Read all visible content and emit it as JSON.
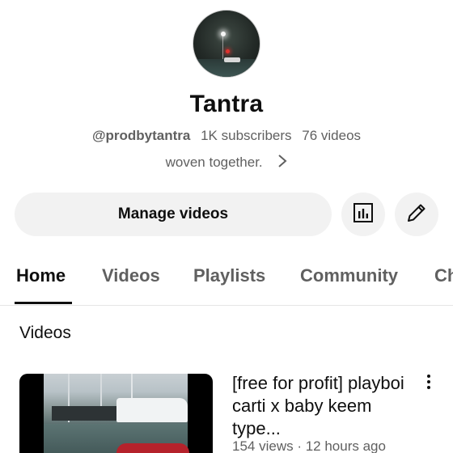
{
  "channel": {
    "name": "Tantra",
    "handle": "@prodbytantra",
    "subscribers": "1K subscribers",
    "videos_count": "76 videos",
    "description": "woven together."
  },
  "actions": {
    "manage_label": "Manage videos",
    "stats_icon": "bar-chart-icon",
    "edit_icon": "pencil-icon"
  },
  "tabs": [
    {
      "label": "Home",
      "active": true
    },
    {
      "label": "Videos",
      "active": false
    },
    {
      "label": "Playlists",
      "active": false
    },
    {
      "label": "Community",
      "active": false
    },
    {
      "label": "Ch",
      "active": false
    }
  ],
  "section": {
    "title": "Videos"
  },
  "video": {
    "title": "[free for profit] playboi carti x baby keem type...",
    "meta": "154 views · 12 hours ago"
  }
}
